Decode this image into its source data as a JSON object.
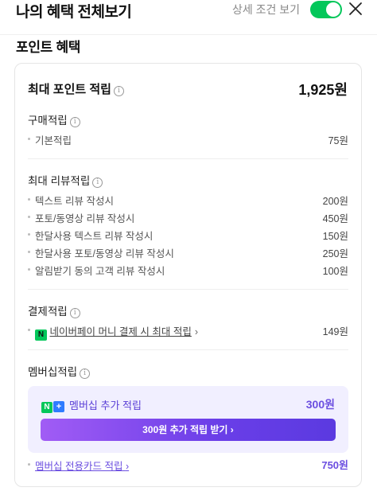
{
  "header": {
    "title": "나의 혜택 전체보기",
    "detail_toggle_label": "상세 조건 보기",
    "detail_toggle_on": true
  },
  "section_title": "포인트 혜택",
  "max_points": {
    "label": "최대 포인트 적립",
    "value": "1,925원"
  },
  "purchase": {
    "title": "구매적립",
    "items": [
      {
        "label": "기본적립",
        "amount": "75원"
      }
    ]
  },
  "review": {
    "title": "최대 리뷰적립",
    "items": [
      {
        "label": "텍스트 리뷰 작성시",
        "amount": "200원"
      },
      {
        "label": "포토/동영상 리뷰 작성시",
        "amount": "450원"
      },
      {
        "label": "한달사용 텍스트 리뷰 작성시",
        "amount": "150원"
      },
      {
        "label": "한달사용 포토/동영상 리뷰 작성시",
        "amount": "250원"
      },
      {
        "label": "알림받기 동의 고객 리뷰 작성시",
        "amount": "100원"
      }
    ]
  },
  "payment": {
    "title": "결제적립",
    "item": {
      "label": "네이버페이 머니 결제 시 최대 적립",
      "amount": "149원",
      "chevron": "›"
    }
  },
  "membership": {
    "title": "멤버십적립",
    "box_label": "멤버십 추가 적립",
    "box_value": "300원",
    "cta_label": "300원 추가 적립 받기 ›",
    "card_label": "멤버십 전용카드 적립",
    "card_chevron": "›",
    "card_amount": "750원"
  },
  "colors": {
    "toggle_on": "#03c75a",
    "accent_purple": "#6b4ee0",
    "member_bg": "#f1efff"
  },
  "icons": {
    "info": "info-circle-icon",
    "close": "close-icon",
    "npay": "naver-pay-icon",
    "membership": "naver-plus-membership-icon"
  }
}
